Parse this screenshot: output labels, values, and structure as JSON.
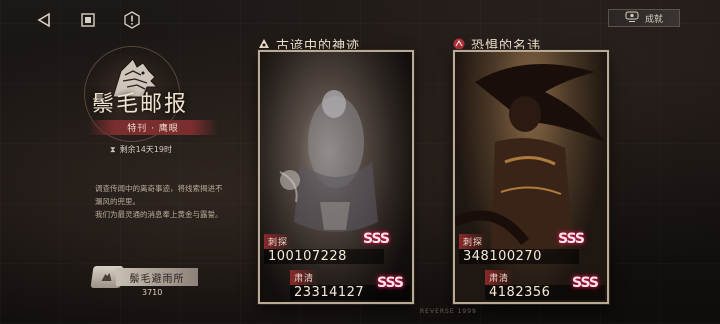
{
  "nav": {
    "back_icon": "back-triangle-icon",
    "home_icon": "stop-square-icon",
    "info_icon": "info-hexagon-icon"
  },
  "achievement": {
    "label": "成就",
    "icon": "achievement-icon"
  },
  "event": {
    "title": "鬃毛邮报",
    "subtitle": "特刊 · 鹰眼",
    "timer_icon": "hourglass-icon",
    "timer": "剩余14天19时",
    "description": [
      "调查传闻中的离奇事迹，将线索揭进不",
      "漏风的兜里。",
      "我们为最灵通的消息奉上黄金与露誓。"
    ]
  },
  "shelter": {
    "name": "鬃毛避雨所",
    "count": "3710",
    "badge_icon": "shelter-badge-icon"
  },
  "cards": [
    {
      "title": "古谚中的神迹",
      "icon": "rune-icon",
      "stat1_label": "刺探",
      "stat1_value": "100107228",
      "stat2_label": "肃清",
      "stat2_value": "23314127",
      "rank1": "SSS",
      "rank2": "SSS"
    },
    {
      "title": "恐惧的名讳",
      "icon": "claw-icon",
      "stat1_label": "刺探",
      "stat1_value": "348100270",
      "stat2_label": "肃清",
      "stat2_value": "4182356",
      "rank1": "SSS",
      "rank2": "SSS"
    }
  ],
  "watermark": "REVERSE 1999",
  "colors": {
    "accent": "#8a2a2a",
    "rank": "#c81a4a",
    "card_border": "#b9aa94"
  }
}
